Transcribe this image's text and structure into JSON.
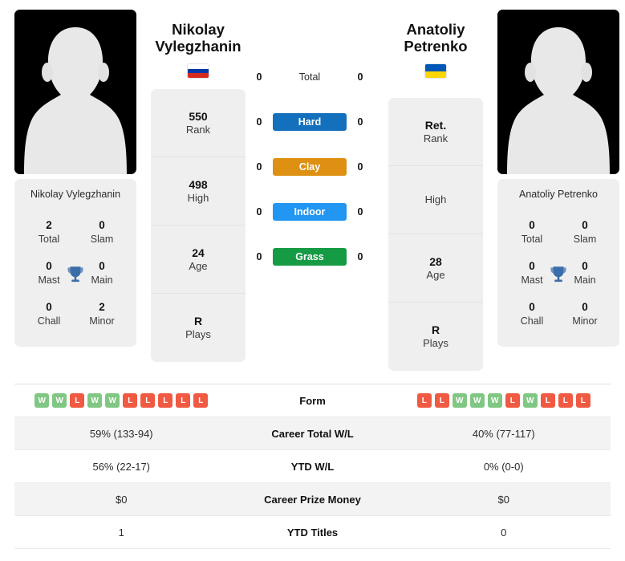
{
  "players": {
    "left": {
      "first_name": "Nikolay",
      "last_name": "Vylegzhanin",
      "full_name": "Nikolay Vylegzhanin",
      "country": "Russia",
      "flag": "russia-flag",
      "rank": "550",
      "rank_label": "Rank",
      "high": "498",
      "high_label": "High",
      "age": "24",
      "age_label": "Age",
      "plays": "R",
      "plays_label": "Plays",
      "titles": {
        "total": "2",
        "total_label": "Total",
        "slam": "0",
        "slam_label": "Slam",
        "mast": "0",
        "mast_label": "Mast",
        "main": "0",
        "main_label": "Main",
        "chall": "0",
        "chall_label": "Chall",
        "minor": "2",
        "minor_label": "Minor"
      }
    },
    "right": {
      "first_name": "Anatoliy",
      "last_name": "Petrenko",
      "full_name": "Anatoliy Petrenko",
      "country": "Ukraine",
      "flag": "ukraine-flag",
      "rank": "Ret.",
      "rank_label": "Rank",
      "high": "",
      "high_label": "High",
      "age": "28",
      "age_label": "Age",
      "plays": "R",
      "plays_label": "Plays",
      "titles": {
        "total": "0",
        "total_label": "Total",
        "slam": "0",
        "slam_label": "Slam",
        "mast": "0",
        "mast_label": "Mast",
        "main": "0",
        "main_label": "Main",
        "chall": "0",
        "chall_label": "Chall",
        "minor": "0",
        "minor_label": "Minor"
      }
    }
  },
  "surfaces": [
    {
      "label": "Total",
      "left": "0",
      "right": "0",
      "color": "",
      "plain": true
    },
    {
      "label": "Hard",
      "left": "0",
      "right": "0",
      "color": "#1370bd",
      "plain": false
    },
    {
      "label": "Clay",
      "left": "0",
      "right": "0",
      "color": "#dd9012",
      "plain": false
    },
    {
      "label": "Indoor",
      "left": "0",
      "right": "0",
      "color": "#2196f3",
      "plain": false
    },
    {
      "label": "Grass",
      "left": "0",
      "right": "0",
      "color": "#169b45",
      "plain": false
    }
  ],
  "comparison": {
    "form_label": "Form",
    "left_form": [
      "W",
      "W",
      "L",
      "W",
      "W",
      "L",
      "L",
      "L",
      "L",
      "L"
    ],
    "right_form": [
      "L",
      "L",
      "W",
      "W",
      "W",
      "L",
      "W",
      "L",
      "L",
      "L"
    ],
    "rows": [
      {
        "label": "Career Total W/L",
        "left": "59% (133-94)",
        "right": "40% (77-117)"
      },
      {
        "label": "YTD W/L",
        "left": "56% (22-17)",
        "right": "0% (0-0)"
      },
      {
        "label": "Career Prize Money",
        "left": "$0",
        "right": "$0"
      },
      {
        "label": "YTD Titles",
        "left": "1",
        "right": "0"
      }
    ]
  },
  "colors": {
    "win_badge": "#81c784",
    "loss_badge": "#f05a43",
    "trophy": "#3a6ea8",
    "card_bg": "#efefef"
  }
}
